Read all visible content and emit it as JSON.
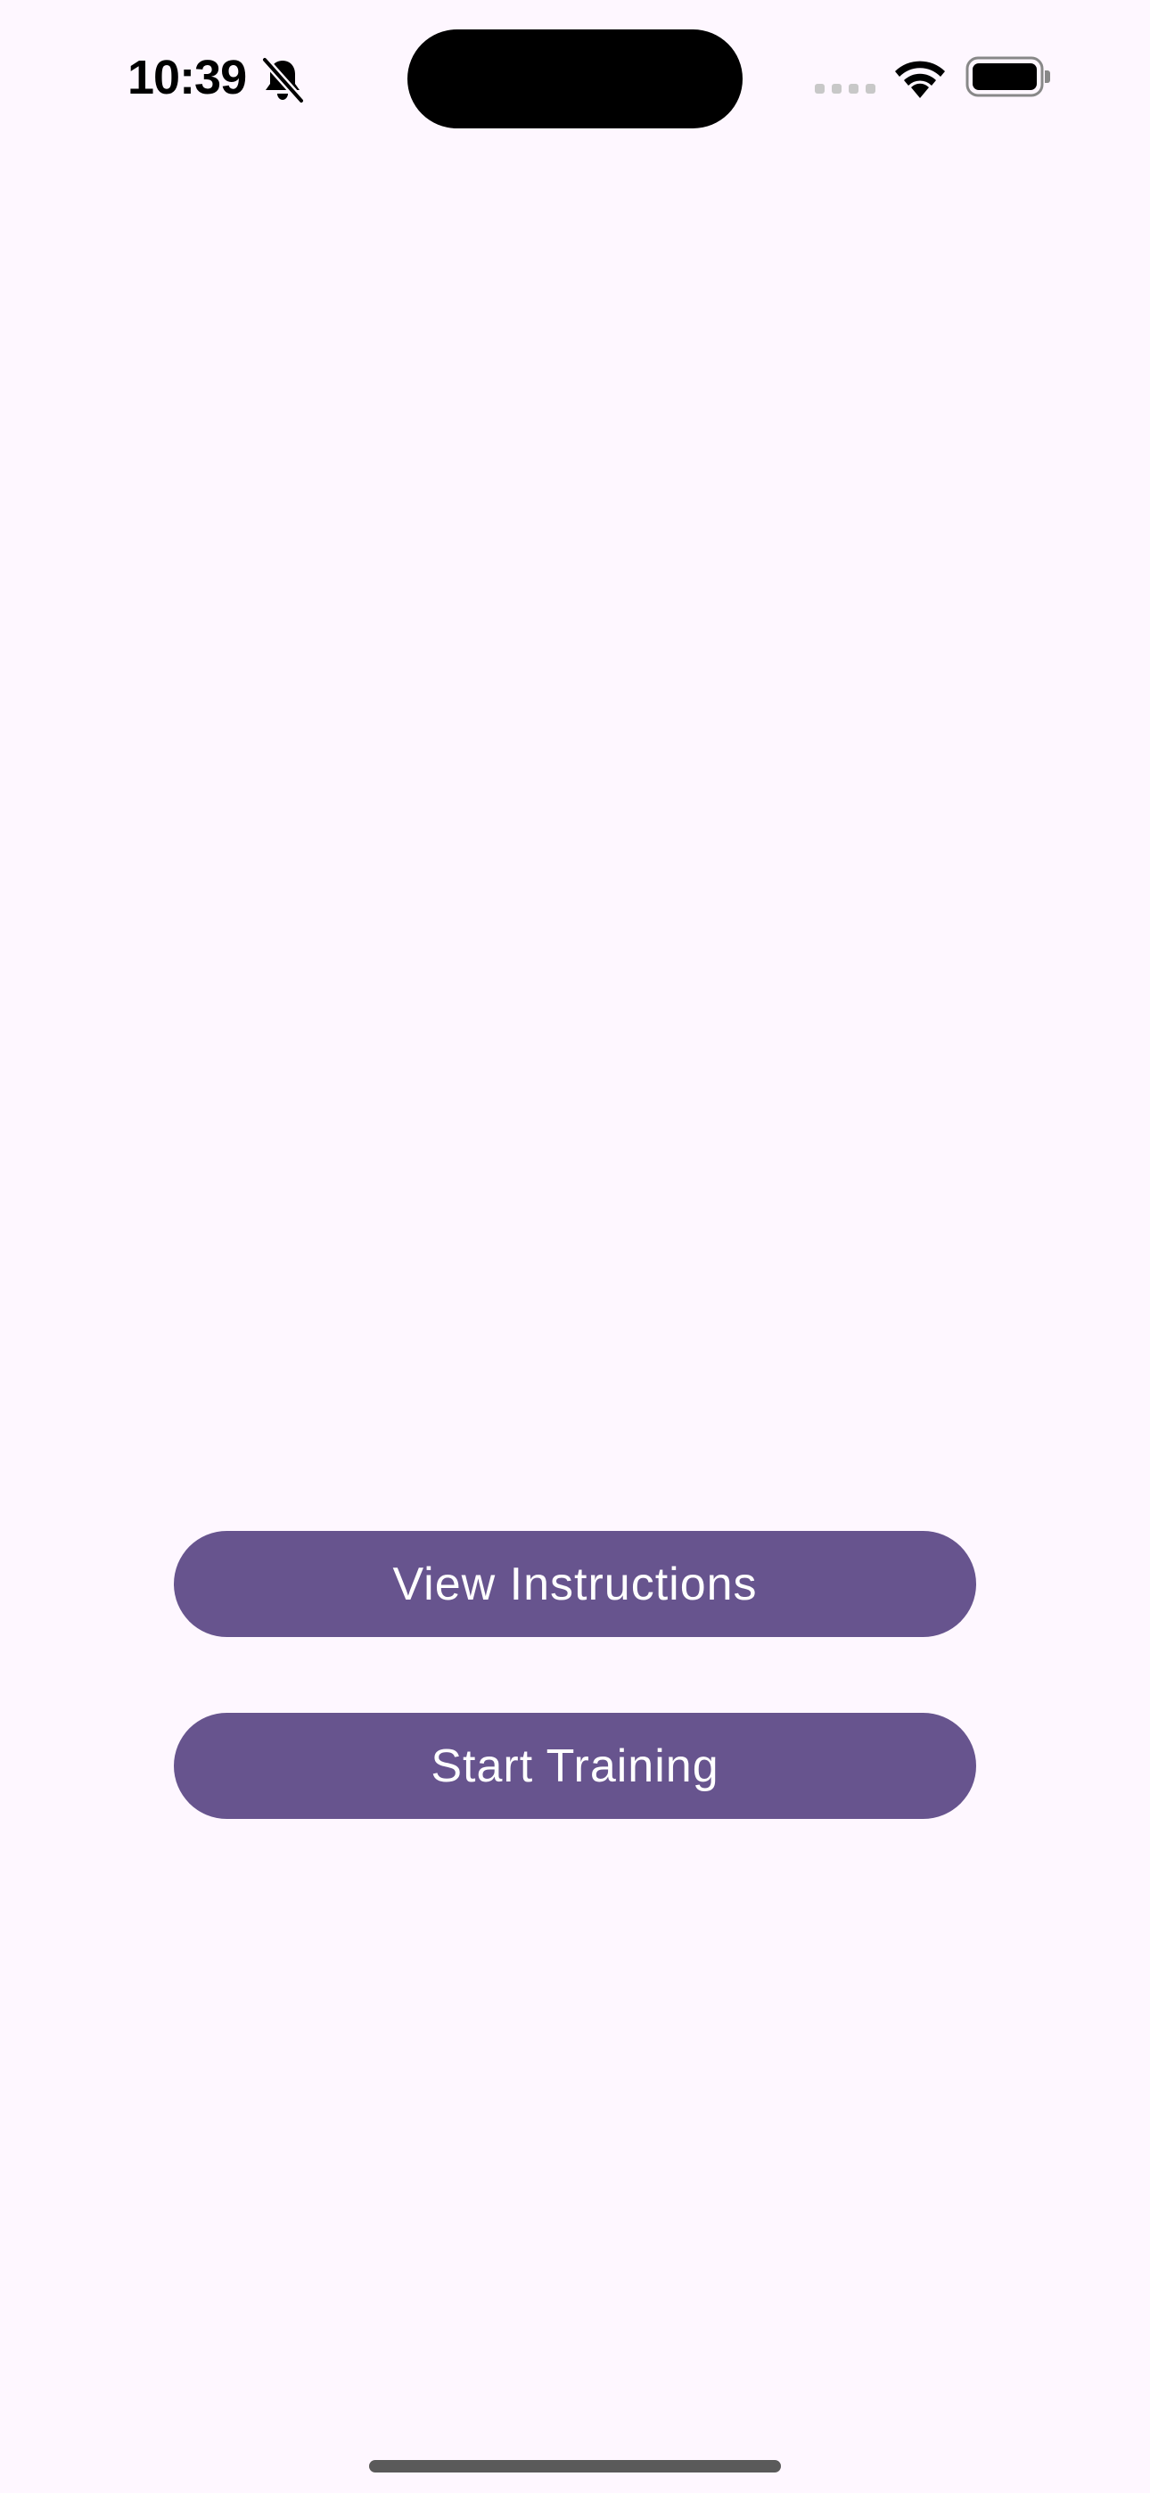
{
  "status_bar": {
    "time": "10:39",
    "icons": [
      "bell-off-icon",
      "cellular-signal-icon",
      "wifi-icon",
      "battery-icon"
    ]
  },
  "main": {
    "buttons": [
      {
        "label": "View Instructions"
      },
      {
        "label": "Start Training"
      }
    ]
  },
  "colors": {
    "background": "#FEF7FF",
    "button_fill": "#67548E",
    "button_text": "#FFFFFF"
  }
}
